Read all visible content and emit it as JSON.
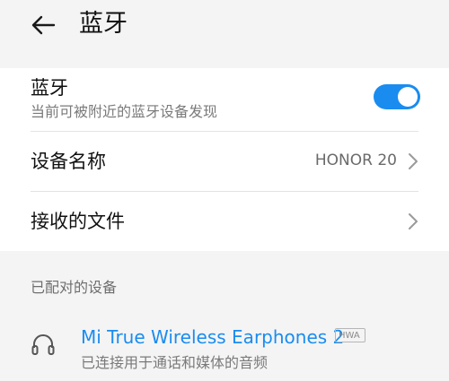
{
  "header": {
    "back_icon": "arrow-left-icon",
    "title": "蓝牙"
  },
  "settings": {
    "bluetooth": {
      "title": "蓝牙",
      "subtitle": "当前可被附近的蓝牙设备发现",
      "enabled": true,
      "accent_color": "#1a8cf0"
    },
    "device_name": {
      "title": "设备名称",
      "value": "HONOR 20"
    },
    "received_files": {
      "title": "接收的文件"
    }
  },
  "paired": {
    "section_title": "已配对的设备",
    "devices": [
      {
        "icon": "headphones-icon",
        "name": "Mi True Wireless Earphones 2",
        "badge": "HWA",
        "status": "已连接用于通话和媒体的音频",
        "name_color": "#1a8cf0"
      }
    ]
  }
}
